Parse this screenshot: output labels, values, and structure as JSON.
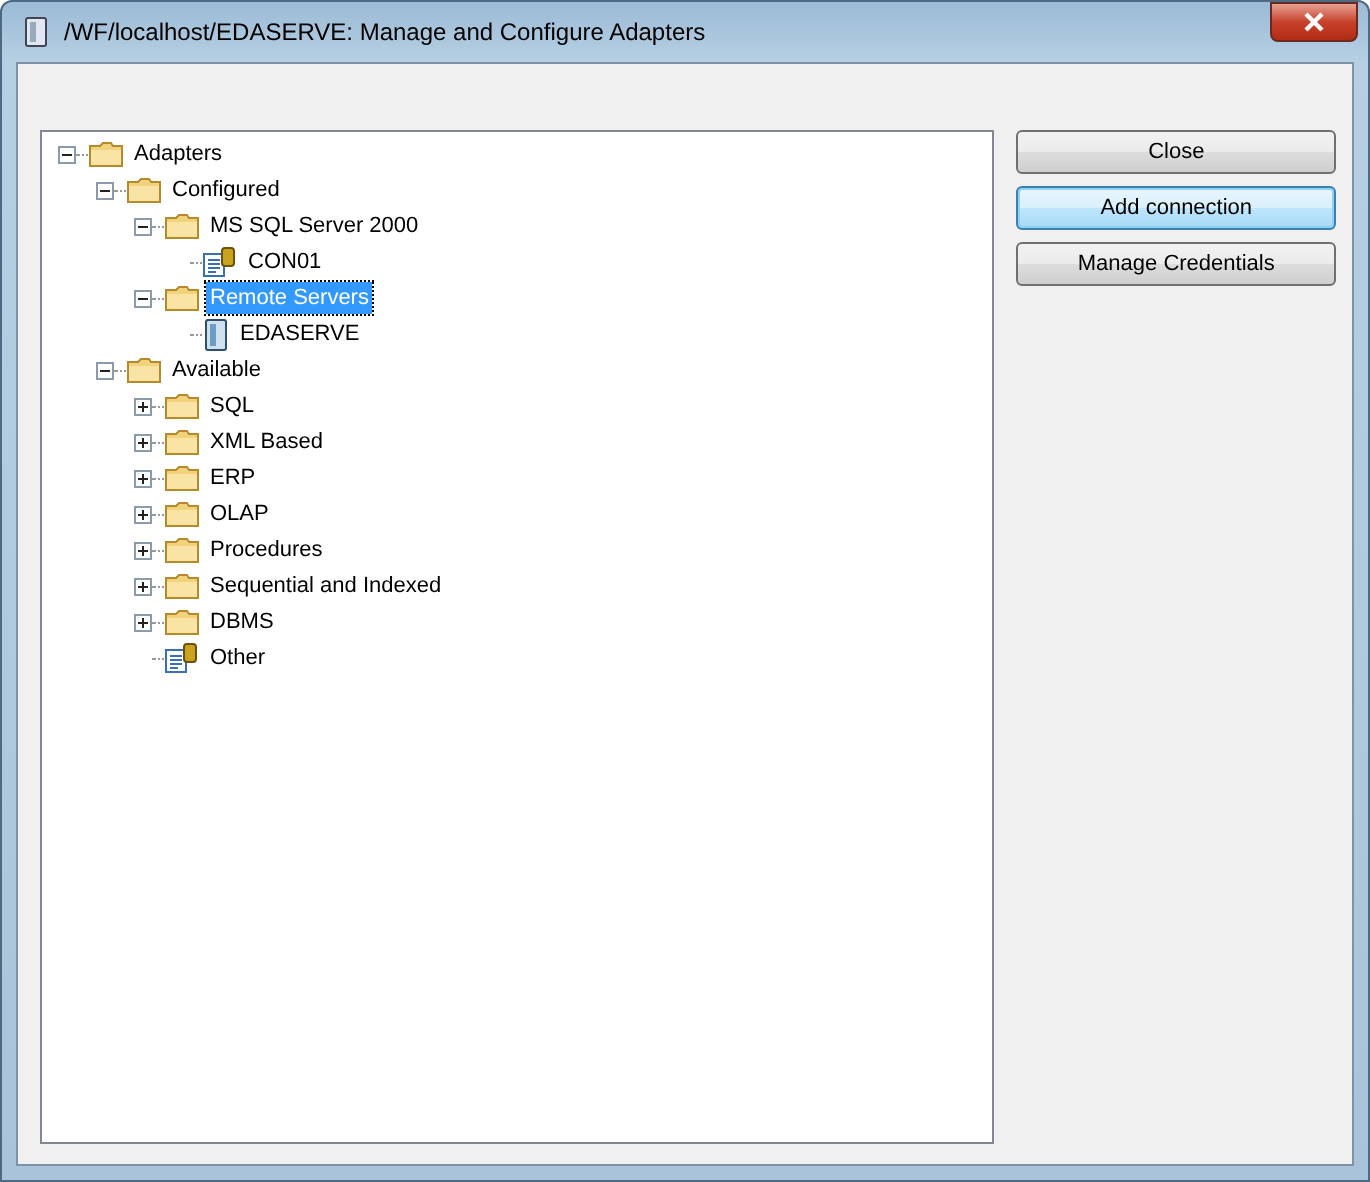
{
  "window": {
    "title": "/WF/localhost/EDASERVE: Manage and Configure Adapters"
  },
  "tree": [
    {
      "label": "Adapters",
      "kind": "folder",
      "expanded": true,
      "selected": false,
      "children": [
        {
          "label": "Configured",
          "kind": "folder",
          "expanded": true,
          "selected": false,
          "children": [
            {
              "label": "MS SQL Server 2000",
              "kind": "folder",
              "expanded": true,
              "selected": false,
              "children": [
                {
                  "label": "CON01",
                  "kind": "adapter",
                  "selected": false
                }
              ]
            },
            {
              "label": "Remote Servers",
              "kind": "folder",
              "expanded": true,
              "selected": true,
              "children": [
                {
                  "label": "EDASERVE",
                  "kind": "server",
                  "selected": false
                }
              ]
            }
          ]
        },
        {
          "label": "Available",
          "kind": "folder",
          "expanded": true,
          "selected": false,
          "children": [
            {
              "label": "SQL",
              "kind": "folder",
              "expanded": false,
              "selected": false
            },
            {
              "label": "XML Based",
              "kind": "folder",
              "expanded": false,
              "selected": false
            },
            {
              "label": "ERP",
              "kind": "folder",
              "expanded": false,
              "selected": false
            },
            {
              "label": "OLAP",
              "kind": "folder",
              "expanded": false,
              "selected": false
            },
            {
              "label": "Procedures",
              "kind": "folder",
              "expanded": false,
              "selected": false
            },
            {
              "label": "Sequential and Indexed",
              "kind": "folder",
              "expanded": false,
              "selected": false
            },
            {
              "label": "DBMS",
              "kind": "folder",
              "expanded": false,
              "selected": false
            },
            {
              "label": "Other",
              "kind": "adapter",
              "selected": false
            }
          ]
        }
      ]
    }
  ],
  "buttons": [
    {
      "label": "Close",
      "focused": false
    },
    {
      "label": "Add connection",
      "focused": true
    },
    {
      "label": "Manage Credentials",
      "focused": false
    }
  ]
}
